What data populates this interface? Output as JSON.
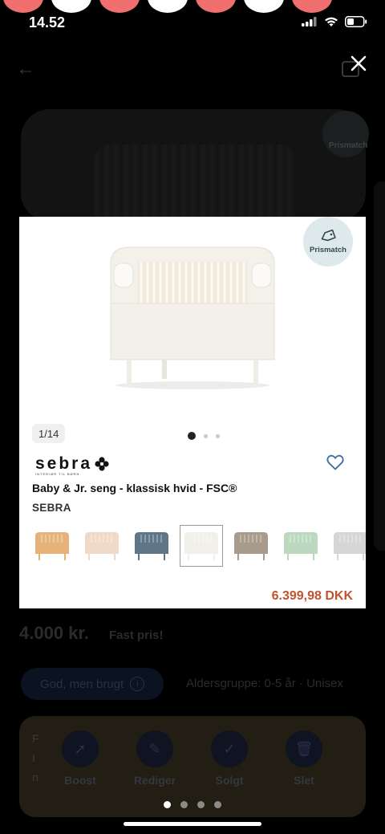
{
  "status_bar": {
    "time": "14.52",
    "dot_colors": [
      "#ef6f6f",
      "#ffffff",
      "#ef6f6f",
      "#ffffff",
      "#ef6f6f",
      "#ffffff",
      "#ef6f6f"
    ]
  },
  "background": {
    "prismatch_label": "Prismatch",
    "price": "4.000 kr.",
    "price_note": "Fast pris!",
    "condition": "God, men brugt",
    "age_group": "Aldersgruppe: 0-5 år · Unisex",
    "toolbar": [
      {
        "label": "Boost",
        "icon": "rocket-icon"
      },
      {
        "label": "Rediger",
        "icon": "pencil-icon"
      },
      {
        "label": "Solgt",
        "icon": "check-icon"
      },
      {
        "label": "Slet",
        "icon": "trash-icon"
      }
    ],
    "side_text": [
      "F",
      "I",
      "n"
    ],
    "pages": {
      "count": 4,
      "active": 1
    }
  },
  "modal": {
    "prismatch_label": "Prismatch",
    "image_counter": "1/14",
    "image_dots": {
      "count": 3,
      "active": 1
    },
    "brand_logo_text": "sebra",
    "brand_logo_sub": "INTERIØR TIL BØRN",
    "product_title": "Baby & Jr. seng - klassisk hvid - FSC®",
    "brand": "SEBRA",
    "variants": [
      {
        "color": "#e6b27a",
        "selected": false
      },
      {
        "color": "#efd9c8",
        "selected": false
      },
      {
        "color": "#5f7588",
        "selected": false
      },
      {
        "color": "#f1f0e9",
        "selected": true
      },
      {
        "color": "#a89b8c",
        "selected": false
      },
      {
        "color": "#bcd9bf",
        "selected": false
      },
      {
        "color": "#d6d6d6",
        "selected": false
      }
    ],
    "price": "6.399,98",
    "currency": "DKK",
    "price_color": "#c0532f"
  }
}
